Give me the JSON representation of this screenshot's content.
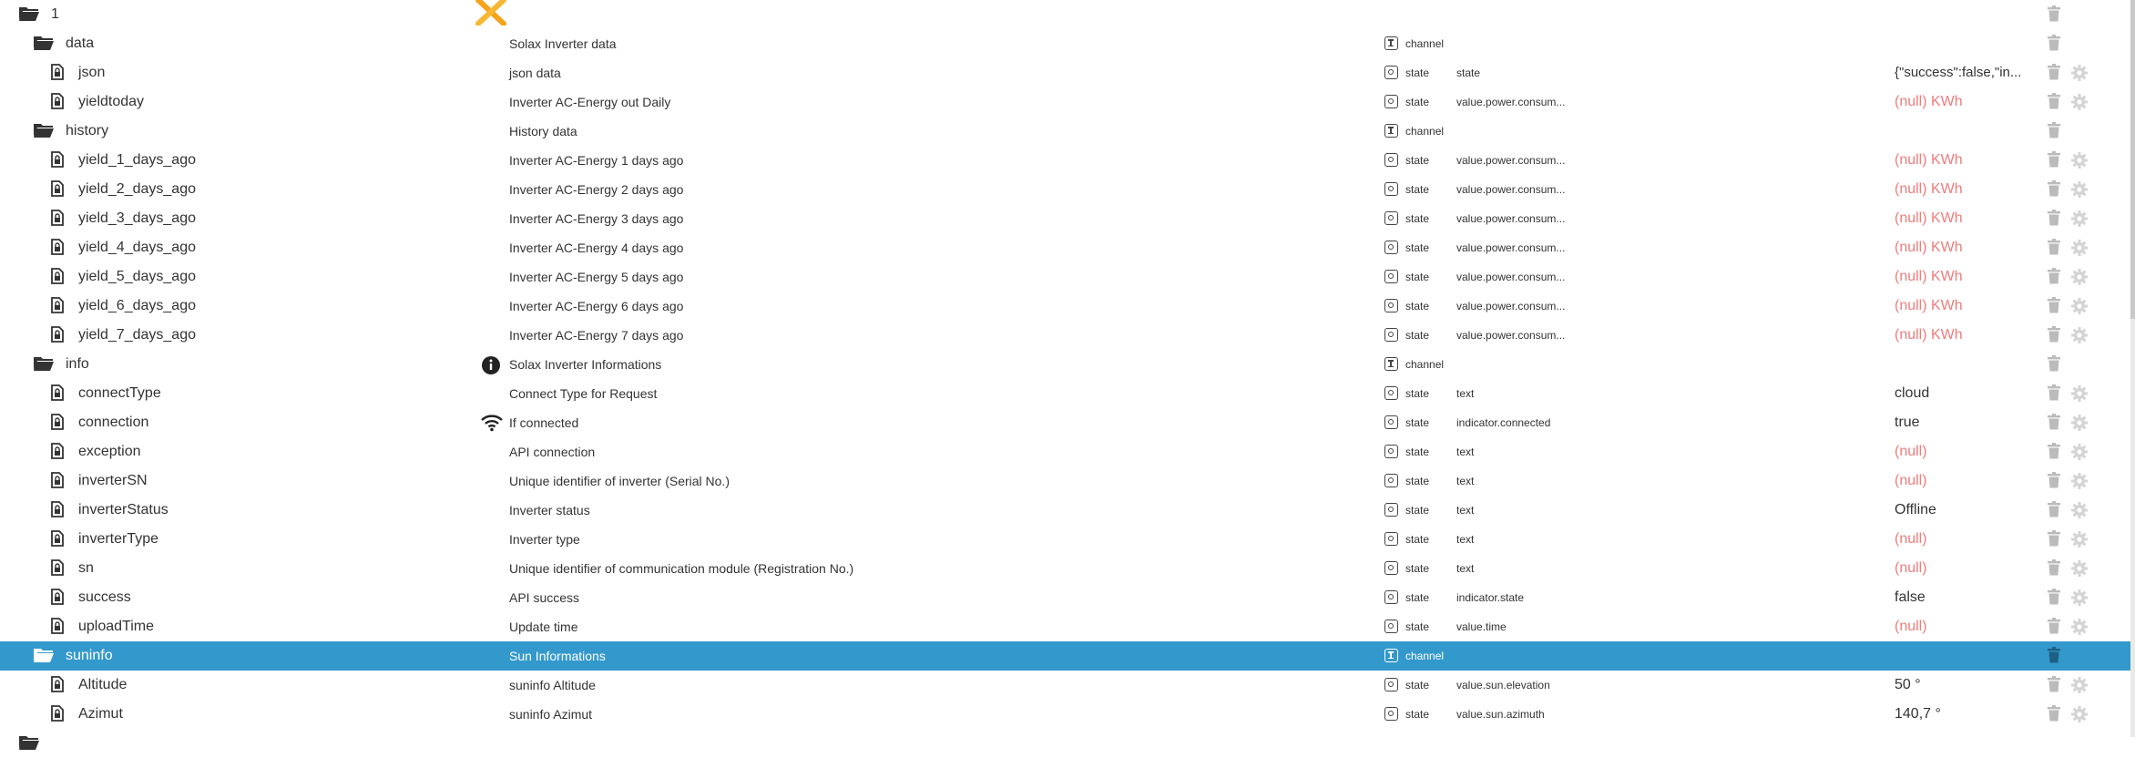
{
  "colors": {
    "selected_row": "#3399cc",
    "null_value": "#ef7c7c",
    "icon": "#333333",
    "action_icon": "#bbbbbb"
  },
  "rows": [
    {
      "id": "1",
      "name": "1",
      "kind": "folder",
      "level": 0,
      "desc": "",
      "type": "",
      "role": "",
      "value": "",
      "brand": "solax-logo-icon"
    },
    {
      "id": "data",
      "name": "data",
      "kind": "folder",
      "level": 1,
      "desc": "Solax Inverter data",
      "type": "channel",
      "role": "",
      "value": ""
    },
    {
      "id": "json",
      "name": "json",
      "kind": "state",
      "level": 2,
      "desc": "json data",
      "type": "state",
      "role": "state",
      "value": "{\"success\":false,\"in..."
    },
    {
      "id": "yieldtoday",
      "name": "yieldtoday",
      "kind": "state",
      "level": 2,
      "desc": "Inverter AC-Energy out Daily",
      "type": "state",
      "role": "value.power.consum...",
      "value": "(null) KWh",
      "value_null": true
    },
    {
      "id": "history",
      "name": "history",
      "kind": "folder",
      "level": 1,
      "desc": "History data",
      "type": "channel",
      "role": "",
      "value": ""
    },
    {
      "id": "yield_1",
      "name": "yield_1_days_ago",
      "kind": "state",
      "level": 2,
      "desc": "Inverter AC-Energy 1 days ago",
      "type": "state",
      "role": "value.power.consum...",
      "value": "(null) KWh",
      "value_null": true
    },
    {
      "id": "yield_2",
      "name": "yield_2_days_ago",
      "kind": "state",
      "level": 2,
      "desc": "Inverter AC-Energy 2 days ago",
      "type": "state",
      "role": "value.power.consum...",
      "value": "(null) KWh",
      "value_null": true
    },
    {
      "id": "yield_3",
      "name": "yield_3_days_ago",
      "kind": "state",
      "level": 2,
      "desc": "Inverter AC-Energy 3 days ago",
      "type": "state",
      "role": "value.power.consum...",
      "value": "(null) KWh",
      "value_null": true
    },
    {
      "id": "yield_4",
      "name": "yield_4_days_ago",
      "kind": "state",
      "level": 2,
      "desc": "Inverter AC-Energy 4 days ago",
      "type": "state",
      "role": "value.power.consum...",
      "value": "(null) KWh",
      "value_null": true
    },
    {
      "id": "yield_5",
      "name": "yield_5_days_ago",
      "kind": "state",
      "level": 2,
      "desc": "Inverter AC-Energy 5 days ago",
      "type": "state",
      "role": "value.power.consum...",
      "value": "(null) KWh",
      "value_null": true
    },
    {
      "id": "yield_6",
      "name": "yield_6_days_ago",
      "kind": "state",
      "level": 2,
      "desc": "Inverter AC-Energy 6 days ago",
      "type": "state",
      "role": "value.power.consum...",
      "value": "(null) KWh",
      "value_null": true
    },
    {
      "id": "yield_7",
      "name": "yield_7_days_ago",
      "kind": "state",
      "level": 2,
      "desc": "Inverter AC-Energy 7 days ago",
      "type": "state",
      "role": "value.power.consum...",
      "value": "(null) KWh",
      "value_null": true
    },
    {
      "id": "info",
      "name": "info",
      "kind": "folder",
      "level": 1,
      "desc": "Solax Inverter Informations",
      "desc_icon": "info-icon",
      "type": "channel",
      "role": "",
      "value": ""
    },
    {
      "id": "connectType",
      "name": "connectType",
      "kind": "state",
      "level": 2,
      "desc": "Connect Type for Request",
      "type": "state",
      "role": "text",
      "value": "cloud"
    },
    {
      "id": "connection",
      "name": "connection",
      "kind": "state",
      "level": 2,
      "desc": "If connected",
      "desc_icon": "wifi-icon",
      "type": "state",
      "role": "indicator.connected",
      "value": "true"
    },
    {
      "id": "exception",
      "name": "exception",
      "kind": "state",
      "level": 2,
      "desc": "API connection",
      "type": "state",
      "role": "text",
      "value": "(null)",
      "value_null": true
    },
    {
      "id": "inverterSN",
      "name": "inverterSN",
      "kind": "state",
      "level": 2,
      "desc": "Unique identifier of inverter (Serial No.)",
      "type": "state",
      "role": "text",
      "value": "(null)",
      "value_null": true
    },
    {
      "id": "inverterStatus",
      "name": "inverterStatus",
      "kind": "state",
      "level": 2,
      "desc": "Inverter status",
      "type": "state",
      "role": "text",
      "value": "Offline"
    },
    {
      "id": "inverterType",
      "name": "inverterType",
      "kind": "state",
      "level": 2,
      "desc": "Inverter type",
      "type": "state",
      "role": "text",
      "value": "(null)",
      "value_null": true
    },
    {
      "id": "sn",
      "name": "sn",
      "kind": "state",
      "level": 2,
      "desc": "Unique identifier of communication module (Registration No.)",
      "type": "state",
      "role": "text",
      "value": "(null)",
      "value_null": true
    },
    {
      "id": "success",
      "name": "success",
      "kind": "state",
      "level": 2,
      "desc": "API success",
      "type": "state",
      "role": "indicator.state",
      "value": "false"
    },
    {
      "id": "uploadTime",
      "name": "uploadTime",
      "kind": "state",
      "level": 2,
      "desc": "Update time",
      "type": "state",
      "role": "value.time",
      "value": "(null)",
      "value_null": true
    },
    {
      "id": "suninfo",
      "name": "suninfo",
      "kind": "folder",
      "level": 1,
      "desc": "Sun Informations",
      "type": "channel",
      "role": "",
      "value": "",
      "selected": true
    },
    {
      "id": "Altitude",
      "name": "Altitude",
      "kind": "state",
      "level": 2,
      "desc": "suninfo Altitude",
      "type": "state",
      "role": "value.sun.elevation",
      "value": "50 °"
    },
    {
      "id": "Azimut",
      "name": "Azimut",
      "kind": "state",
      "level": 2,
      "desc": "suninfo Azimut",
      "type": "state",
      "role": "value.sun.azimuth",
      "value": "140,7 °"
    },
    {
      "id": "next",
      "name": "",
      "kind": "folder",
      "level": 0,
      "desc": "",
      "type": "",
      "role": "",
      "value": ""
    }
  ]
}
